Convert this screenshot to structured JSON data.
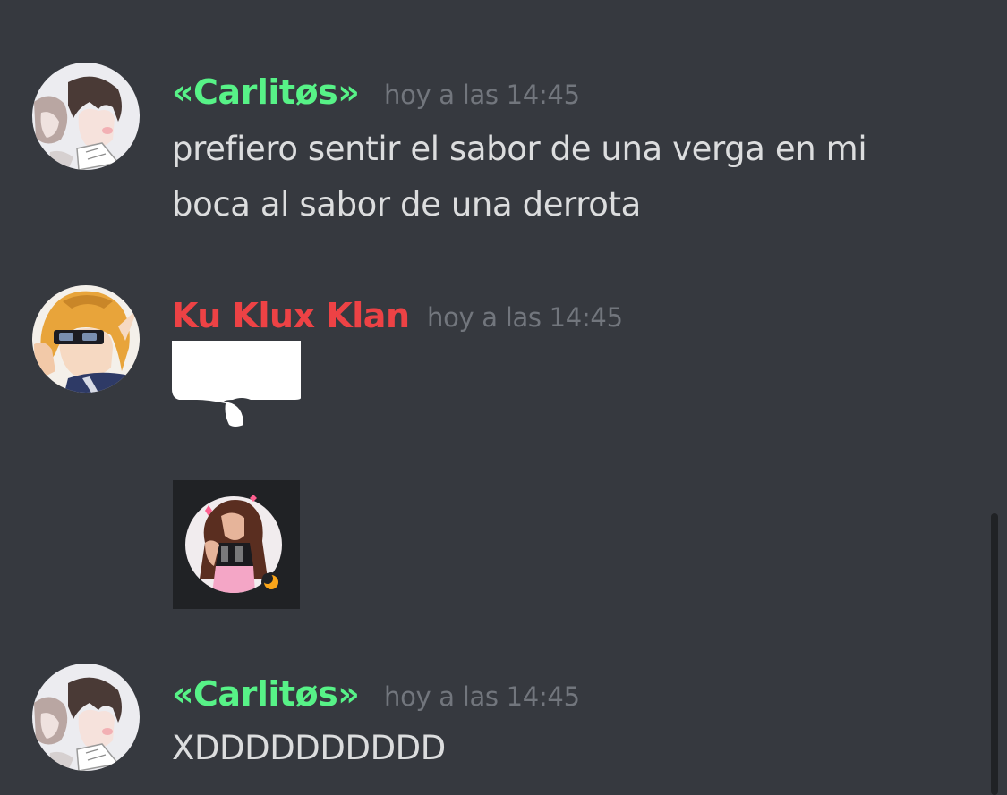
{
  "colors": {
    "background": "#36393f",
    "username_green": "#57f287",
    "username_red": "#ed4245",
    "timestamp": "#72767d",
    "message_text": "#dcddde"
  },
  "messages": [
    {
      "author": "«Carlitøs»",
      "author_color": "#57f287",
      "timestamp": "hoy a las 14:45",
      "content": "prefiero sentir el sabor de una verga en mi boca al sabor de una derrota",
      "avatar_icon": "anime-avatar-brown-hair"
    },
    {
      "author": "Ku Klux Klan",
      "author_color": "#ed4245",
      "timestamp": "hoy a las 14:45",
      "attachments": [
        "speech-bubble-sticker",
        "profile-picture-image"
      ],
      "avatar_icon": "anime-avatar-blonde-sunglasses"
    },
    {
      "author": "«Carlitøs»",
      "author_color": "#57f287",
      "timestamp": "hoy a las 14:45",
      "content": "XDDDDDDDDDD",
      "avatar_icon": "anime-avatar-brown-hair"
    }
  ]
}
